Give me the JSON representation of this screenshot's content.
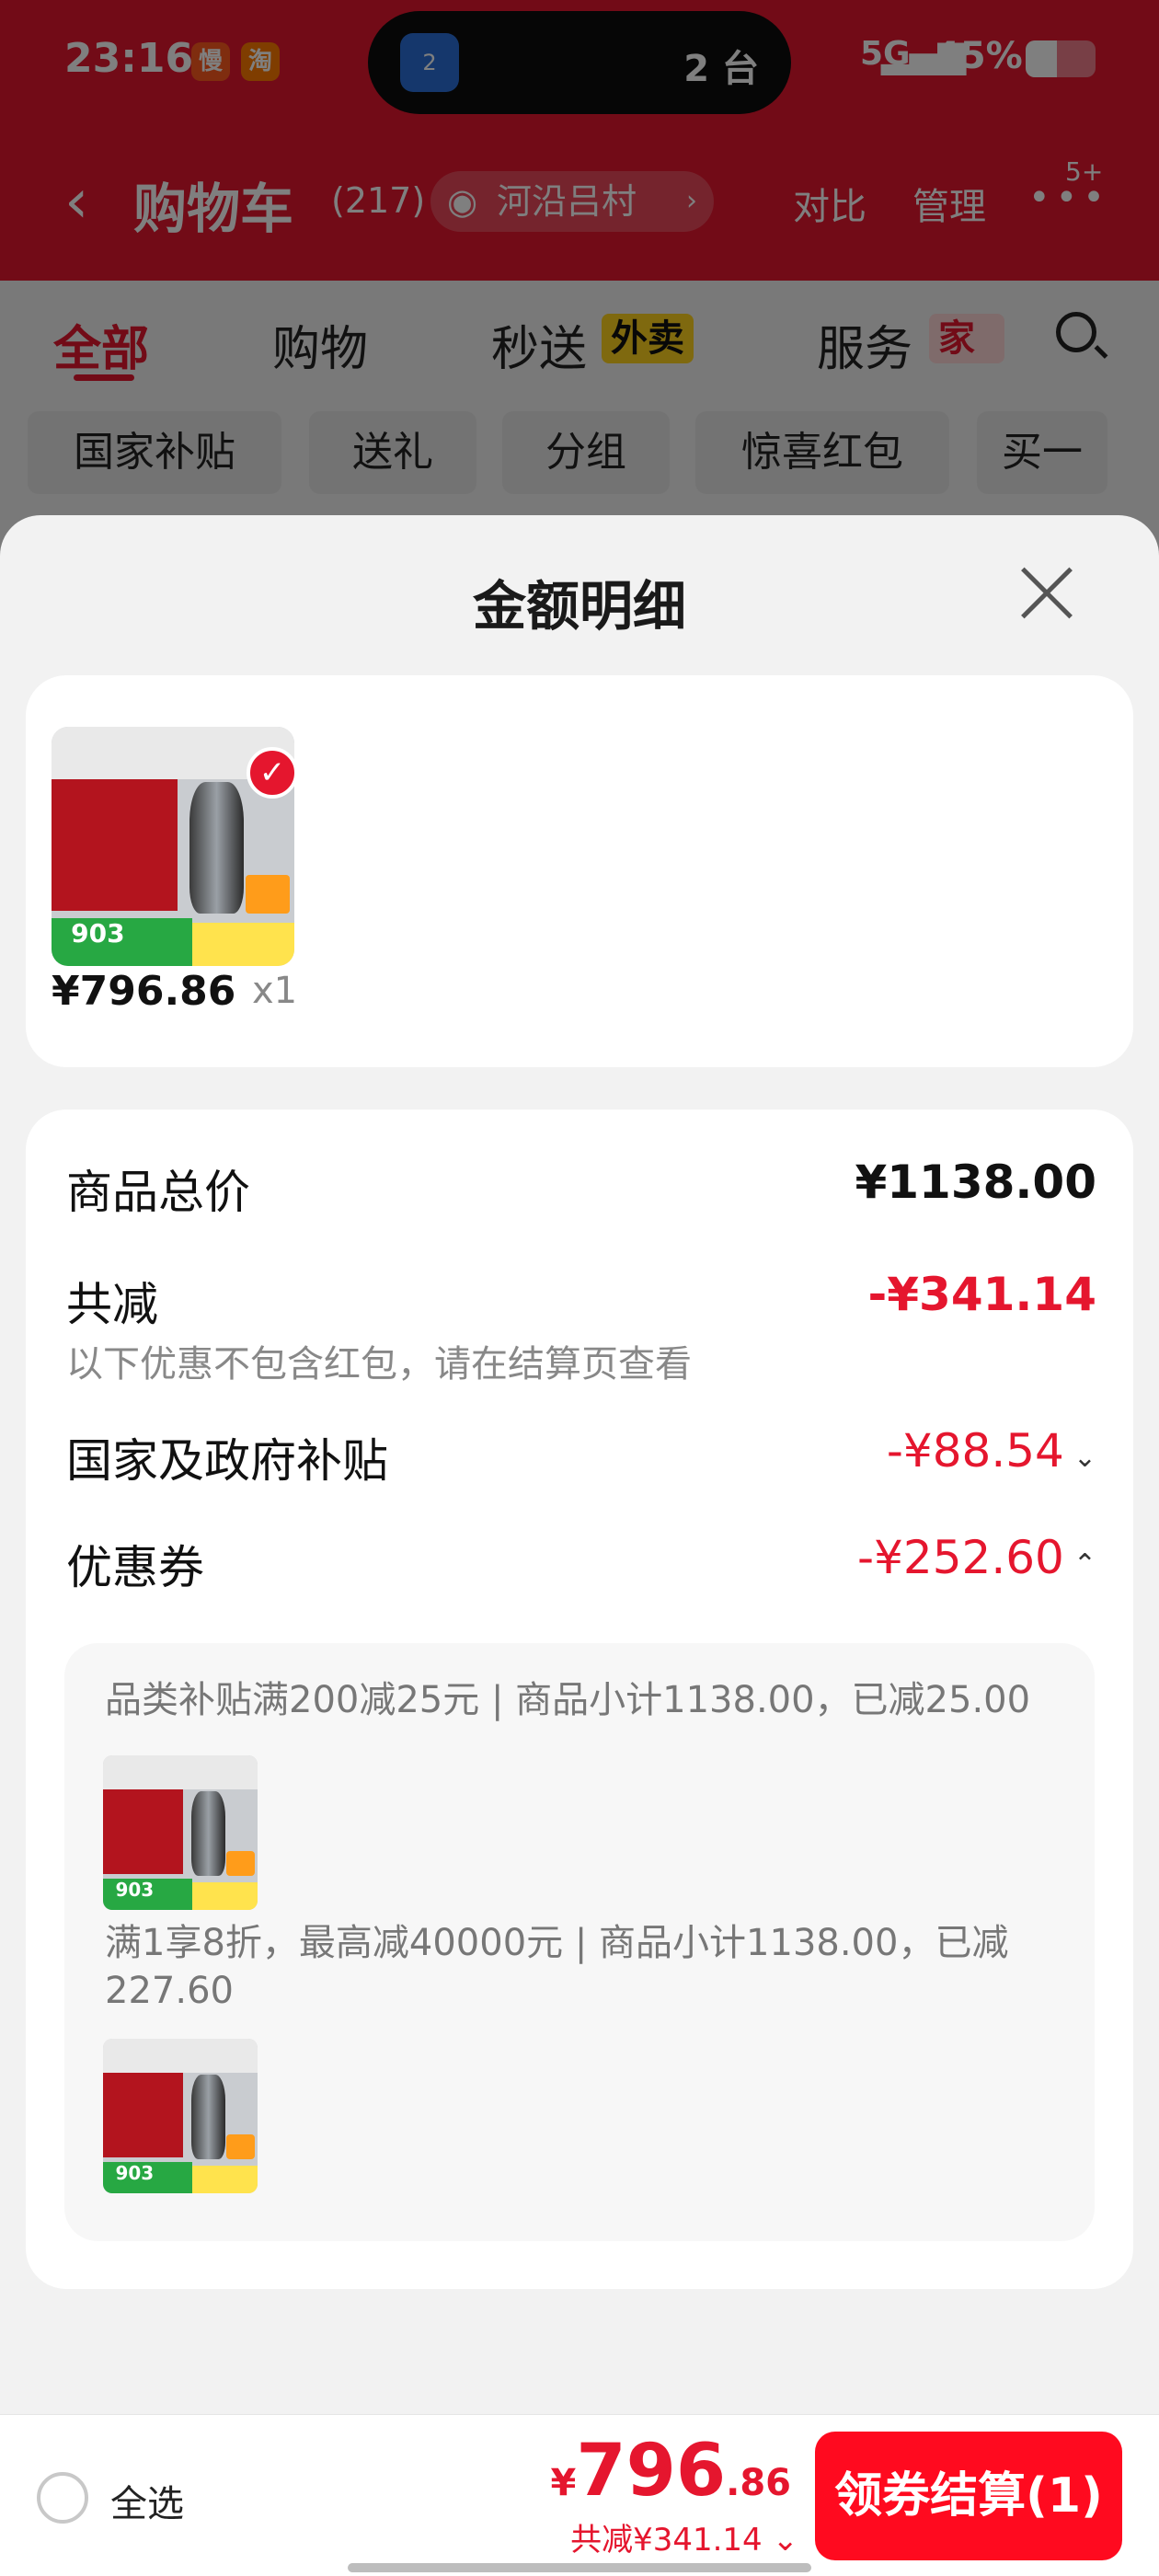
{
  "status": {
    "time": "23:16",
    "app_badge_1": "慢",
    "app_badge_2": "淘",
    "island_icon": "2",
    "island_text": "2 台",
    "network": "5G",
    "battery": "45%",
    "battery_level": 0.45
  },
  "header": {
    "title": "购物车",
    "count": "(217)",
    "location": "河沿吕村",
    "compare": "对比",
    "manage": "管理",
    "more_badge": "5+"
  },
  "tabs": [
    {
      "label": "全部",
      "active": true
    },
    {
      "label": "购物"
    },
    {
      "label": "秒送",
      "tag": "外卖"
    },
    {
      "label": "服务",
      "tag": "家政"
    }
  ],
  "chips": [
    "国家补贴",
    "送礼",
    "分组",
    "惊喜红包",
    "买一"
  ],
  "sheet": {
    "title": "金额明细",
    "item": {
      "price": "¥796.86",
      "qty": "x1",
      "image_num": "903"
    },
    "rows": {
      "total_label": "商品总价",
      "total_value": "¥1138.00",
      "reduce_label": "共减",
      "reduce_value": "-¥341.14",
      "reduce_note": "以下优惠不包含红包，请在结算页查看",
      "subsidy_label": "国家及政府补贴",
      "subsidy_value": "-¥88.54",
      "coupon_label": "优惠券",
      "coupon_value": "-¥252.60"
    },
    "coupons": [
      {
        "text": "品类补贴满200减25元 | 商品小计1138.00，已减25.00"
      },
      {
        "text": "满1享8折，最高减40000元 | 商品小计1138.00，已减227.60"
      }
    ]
  },
  "bottom": {
    "select_all": "全选",
    "currency": "¥",
    "total_int": "796",
    "total_dec": ".86",
    "saved": "共减¥341.14",
    "checkout": "领券结算(1)"
  }
}
